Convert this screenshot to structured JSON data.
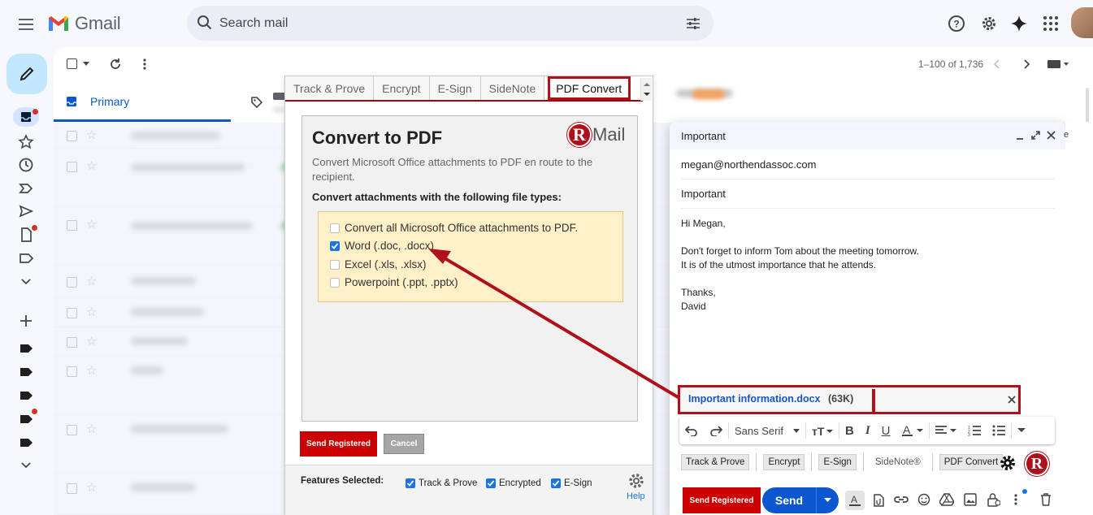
{
  "app": {
    "name": "Gmail"
  },
  "search": {
    "placeholder": "Search mail"
  },
  "toolbar": {
    "pagination": "1–100 of 1,736"
  },
  "tabs": {
    "primary": "Primary"
  },
  "rmail": {
    "tabs": [
      "Track & Prove",
      "Encrypt",
      "E-Sign",
      "SideNote",
      "PDF Convert"
    ],
    "title": "Convert to PDF",
    "logo_r": "R",
    "logo_text": "Mail",
    "description": "Convert Microsoft Office attachments to PDF en route to the recipient.",
    "subtitle": "Convert attachments with the following file types:",
    "options": [
      {
        "label": "Convert all Microsoft Office attachments to PDF.",
        "checked": false
      },
      {
        "label": "Word (.doc, .docx)",
        "checked": true
      },
      {
        "label": "Excel (.xls, .xlsx)",
        "checked": false
      },
      {
        "label": "Powerpoint (.ppt, .pptx)",
        "checked": false
      }
    ],
    "send_registered": "Send Registered",
    "cancel": "Cancel",
    "features_label": "Features Selected:",
    "features": [
      "Track & Prove",
      "Encrypted",
      "E-Sign"
    ],
    "help": "Help"
  },
  "compose": {
    "title": "Important",
    "to": "megan@northendassoc.com",
    "subject": "Important",
    "body": {
      "greeting": "Hi Megan,",
      "line1": "Don't forget to inform Tom about the meeting tomorrow.",
      "line2": "It is of the utmost importance that he attends.",
      "closing": "Thanks,",
      "signature": "David"
    },
    "attachment": {
      "name": "Important information.docx",
      "size": "(63K)"
    },
    "font": "Sans Serif",
    "rmail_buttons": [
      "Track & Prove",
      "Encrypt",
      "E-Sign",
      "SideNote®",
      "PDF Convert"
    ],
    "send_registered": "Send Registered",
    "send": "Send"
  },
  "colors": {
    "accent": "#0b57d0",
    "rmail_red": "#b0101a",
    "compose_btn": "#c2e7ff"
  }
}
